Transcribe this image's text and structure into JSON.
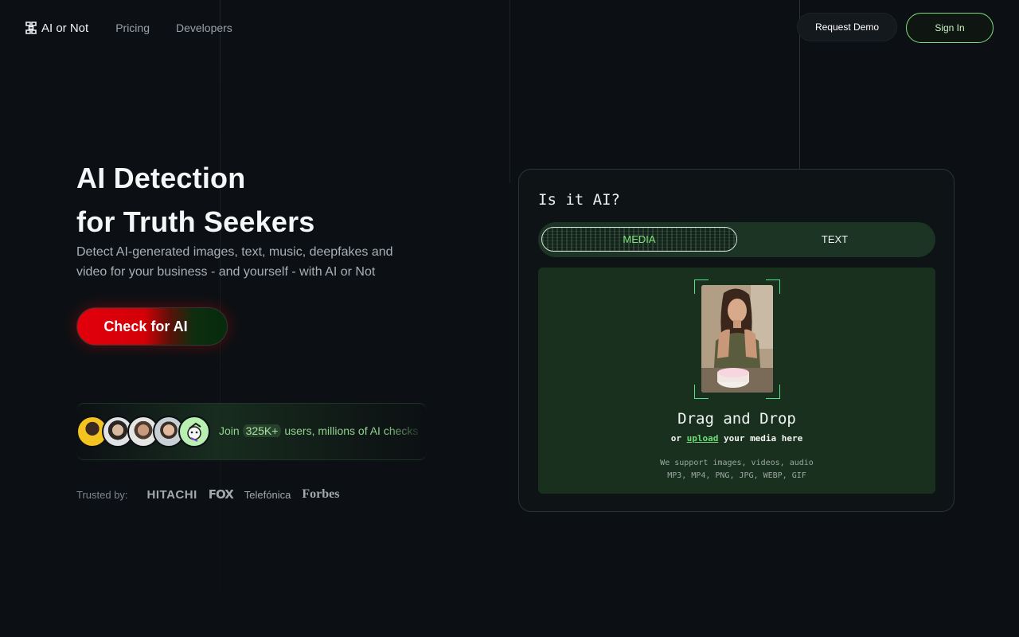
{
  "header": {
    "logo_text": "AI or Not",
    "nav": [
      {
        "label": "Pricing"
      },
      {
        "label": "Developers"
      }
    ],
    "request_demo_label": "Request Demo",
    "sign_in_label": "Sign In"
  },
  "hero": {
    "title_line1": "AI Detection",
    "title_line2": "for Truth Seekers",
    "subtitle": "Detect AI-generated images, text, music, deepfakes and video for your business - and yourself - with AI or Not",
    "cta_label": "Check for AI"
  },
  "social_proof": {
    "prefix": "Join ",
    "count": "325K+",
    "suffix": " users, millions of AI checks"
  },
  "trusted": {
    "label": "Trusted by:",
    "brands": [
      "HITACHI",
      "FOX",
      "Telefónica",
      "Forbes"
    ]
  },
  "detector": {
    "title": "Is it AI?",
    "tabs": {
      "media": "MEDIA",
      "text": "TEXT"
    },
    "active_tab": "MEDIA",
    "drop_title": "Drag and Drop",
    "drop_or": "or ",
    "drop_upload": "upload",
    "drop_rest": " your media here",
    "support_line1": "We support images, videos, audio",
    "support_line2": "MP3, MP4, PNG, JPG, WEBP, GIF"
  },
  "colors": {
    "background": "#0c1014",
    "accent_green": "#7dde7f",
    "cta_red": "#e2000c",
    "dropzone": "#19301f"
  }
}
